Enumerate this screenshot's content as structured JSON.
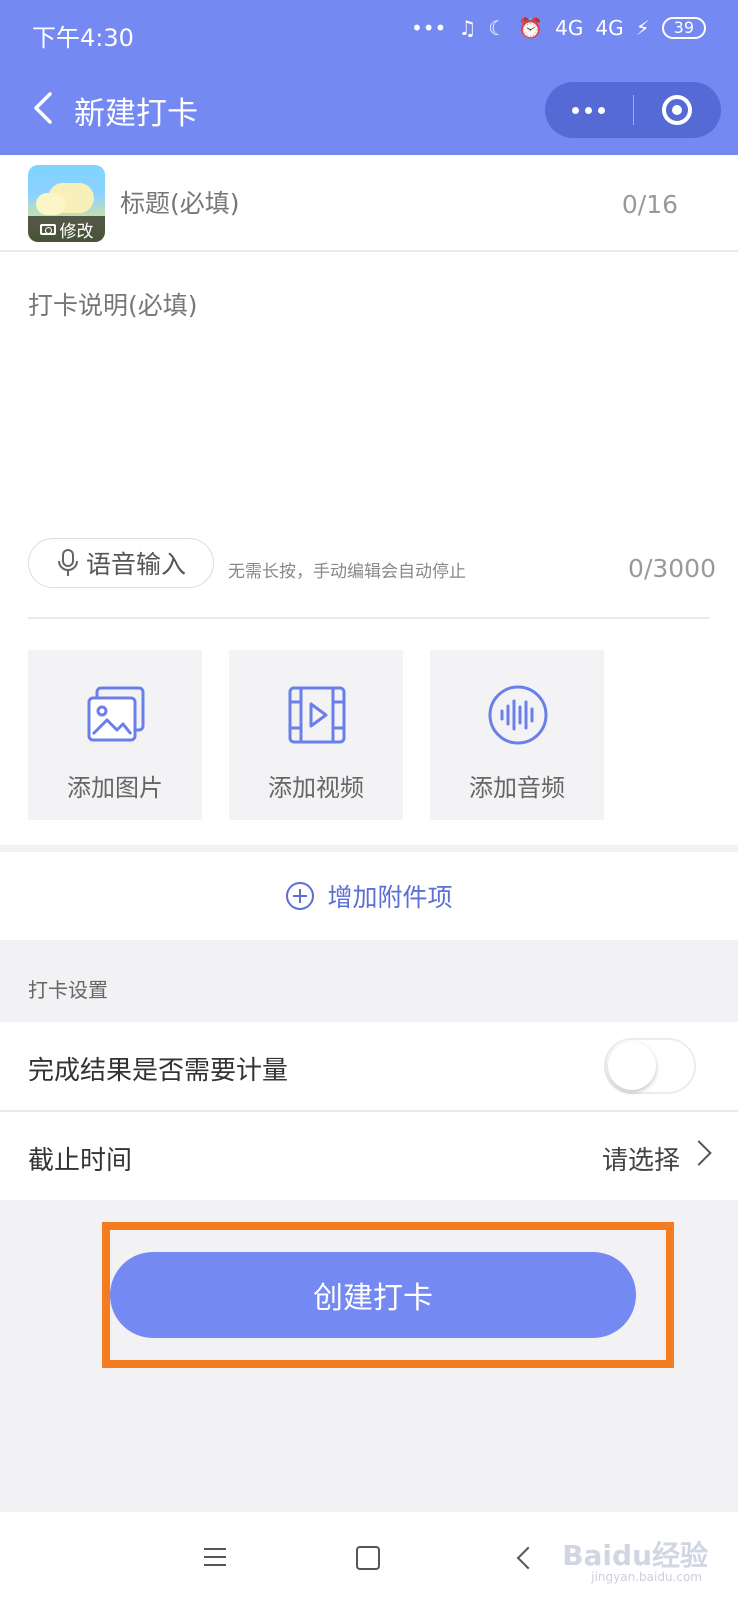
{
  "status_bar": {
    "time": "下午4:30",
    "network_1": "4G",
    "network_2": "4G",
    "battery": "39"
  },
  "nav": {
    "title": "新建打卡"
  },
  "cover": {
    "edit_label": "修改"
  },
  "form": {
    "title_placeholder": "标题(必填)",
    "title_count": "0/16",
    "desc_placeholder": "打卡说明(必填)",
    "voice_button": "语音输入",
    "voice_hint": "无需长按，手动编辑会自动停止",
    "desc_count": "0/3000"
  },
  "attachments": [
    {
      "label": "添加图片",
      "icon": "image-icon"
    },
    {
      "label": "添加视频",
      "icon": "video-icon"
    },
    {
      "label": "添加音频",
      "icon": "audio-icon"
    }
  ],
  "add_attachment": "增加附件项",
  "settings": {
    "section_title": "打卡设置",
    "measure_label": "完成结果是否需要计量",
    "measure_enabled": false,
    "deadline_label": "截止时间",
    "deadline_value": "请选择"
  },
  "create_button": "创建打卡",
  "watermark": {
    "brand": "Baidu经验",
    "url": "jingyan.baidu.com"
  },
  "colors": {
    "primary": "#7489f1",
    "highlight": "#f47b20",
    "link": "#5b6fd6"
  }
}
